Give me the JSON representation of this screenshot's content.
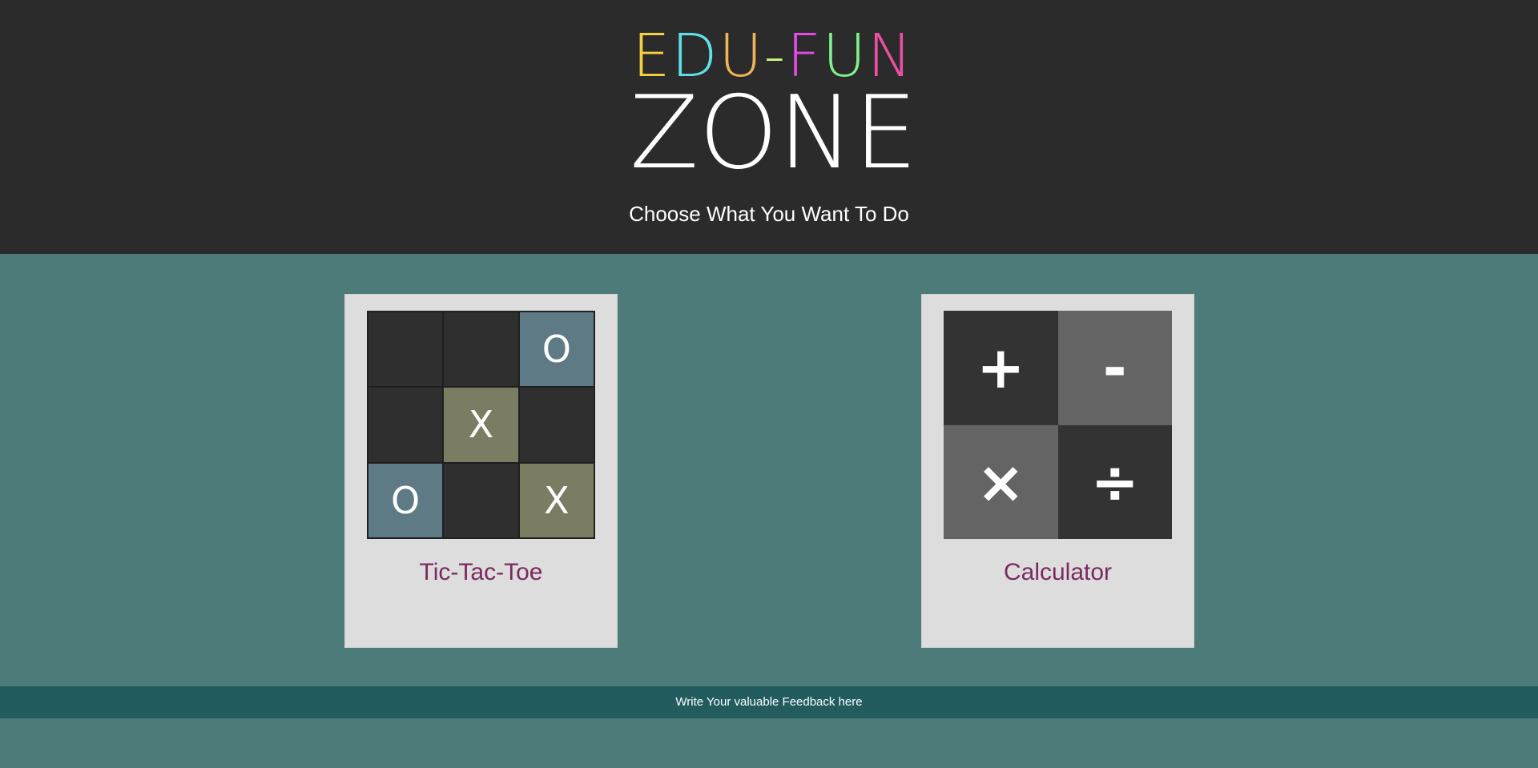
{
  "logo": {
    "line1_parts": [
      {
        "text": "E",
        "color": "#f5d142"
      },
      {
        "text": "D",
        "color": "#5ee0e6"
      },
      {
        "text": "U",
        "color": "#f0b455"
      },
      {
        "text": "-",
        "color": "#c8f07a"
      },
      {
        "text": "F",
        "color": "#e24ae6"
      },
      {
        "text": "U",
        "color": "#7ff08a"
      },
      {
        "text": "N",
        "color": "#ea4fa3"
      }
    ],
    "line2": "ZONE"
  },
  "subtitle": "Choose What You Want To Do",
  "cards": {
    "tictactoe": {
      "label": "Tic-Tac-Toe",
      "cells": [
        "",
        "",
        "O",
        "",
        "X",
        "",
        "O",
        "",
        "X"
      ]
    },
    "calculator": {
      "label": "Calculator",
      "symbols": [
        "+",
        "-",
        "×",
        "÷"
      ]
    }
  },
  "feedback": "Write Your valuable Feedback here",
  "colors": {
    "header_bg": "#2b2b2b",
    "page_bg": "#4d7b79",
    "card_bg": "#dddddd",
    "label_color": "#7a2a5e",
    "feedback_bg": "#225c5e"
  }
}
